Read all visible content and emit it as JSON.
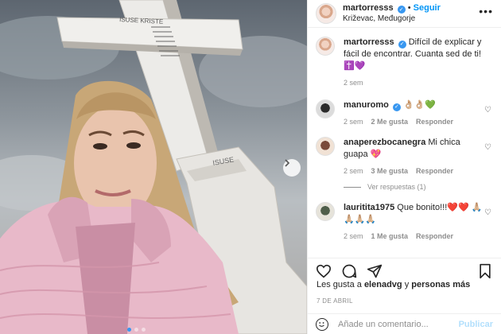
{
  "post": {
    "username": "martorresss",
    "follow_label": "Seguir",
    "location": "Križevac, Međugorje",
    "more_icon": "more-horizontal-icon",
    "caption": "Difícil de explicar y fácil de encontrar. Cuanta sed de ti!",
    "caption_emoji": "✝️💜",
    "caption_age": "2 sem",
    "likes_prefix": "Les gusta a",
    "likes_user": "elenadvg",
    "likes_middle": "y",
    "likes_others": "personas más",
    "date": "7 DE ABRIL"
  },
  "photo": {
    "cross_text_top": "ISUSE KRISTE",
    "cross_text_base": "ISUSE"
  },
  "comments": [
    {
      "user": "manuromo",
      "verified": true,
      "text": "👌🏼👌🏼💚",
      "age": "2 sem",
      "likes": "2 Me gusta",
      "reply": "Responder"
    },
    {
      "user": "anaperezbocanegra",
      "verified": false,
      "text": "Mi chica guapa 💖",
      "age": "2 sem",
      "likes": "3 Me gusta",
      "reply": "Responder",
      "replies_label": "Ver respuestas (1)"
    },
    {
      "user": "lauritita1975",
      "verified": false,
      "text": "Que bonito!!!❤️❤️ 🙏🏼🙏🏼🙏🏼🙏🏼",
      "age": "2 sem",
      "likes": "1 Me gusta",
      "reply": "Responder"
    }
  ],
  "actions": {
    "icons": [
      "heart-icon",
      "comment-icon",
      "share-icon",
      "bookmark-icon"
    ]
  },
  "composer": {
    "placeholder": "Añade un comentario...",
    "publish_label": "Publicar"
  },
  "colors": {
    "accent": "#0095f6",
    "verified": "#3897f0",
    "muted": "#8e8e8e",
    "publish_disabled": "#b2dffc"
  }
}
